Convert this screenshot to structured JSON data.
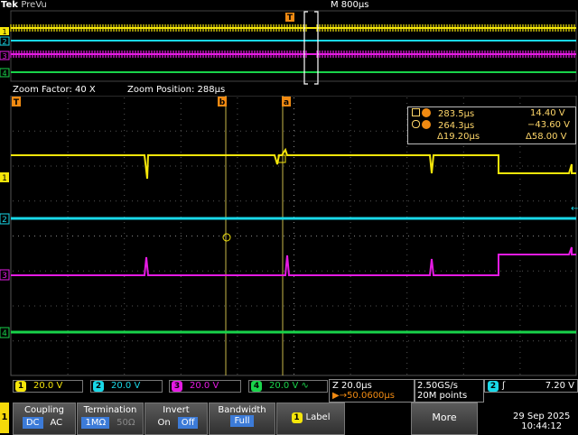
{
  "header": {
    "brand": "Tek",
    "mode": "PreVu",
    "timebase": "M 800µs"
  },
  "zoom": {
    "factor_label": "Zoom Factor: 40 X",
    "position_label": "Zoom Position: 288µs"
  },
  "markers": {
    "trigger": "T",
    "cursor_a": "a",
    "cursor_b": "b"
  },
  "channel_markers": [
    "1",
    "2",
    "3",
    "4"
  ],
  "cursors": {
    "row_a": {
      "time": "283.5µs",
      "volt": "14.40 V"
    },
    "row_b": {
      "time": "264.3µs",
      "volt": "−43.60 V"
    },
    "row_d": {
      "time": "Δ19.20µs",
      "volt": "Δ58.00 V"
    }
  },
  "channels": [
    {
      "num": "1",
      "scale": "20.0 V",
      "color": "#f5e60a"
    },
    {
      "num": "2",
      "scale": "20.0 V",
      "color": "#19d8e8"
    },
    {
      "num": "3",
      "scale": "20.0 V",
      "color": "#e51be3"
    },
    {
      "num": "4",
      "scale": "20.0 V",
      "color": "#19d34a"
    }
  ],
  "horiz": {
    "zoom_scale": "Z 20.0µs",
    "offset": "▶→50.0600µs"
  },
  "acq": {
    "rate": "2.50GS/s",
    "points": "20M points"
  },
  "trigger": {
    "source": "2",
    "slope": "ʃ",
    "level": "7.20 V"
  },
  "menu": {
    "channel_tab": "1",
    "coupling": {
      "title": "Coupling",
      "opt1": "DC",
      "opt2": "AC"
    },
    "termination": {
      "title": "Termination",
      "opt1": "1MΩ",
      "opt2": "50Ω"
    },
    "invert": {
      "title": "Invert",
      "opt1": "On",
      "opt2": "Off"
    },
    "bandwidth": {
      "title": "Bandwidth",
      "value": "Full"
    },
    "label": {
      "num": "1",
      "title": "Label"
    },
    "more": "More"
  },
  "datetime": {
    "date": "29 Sep  2025",
    "time": "10:44:12"
  }
}
